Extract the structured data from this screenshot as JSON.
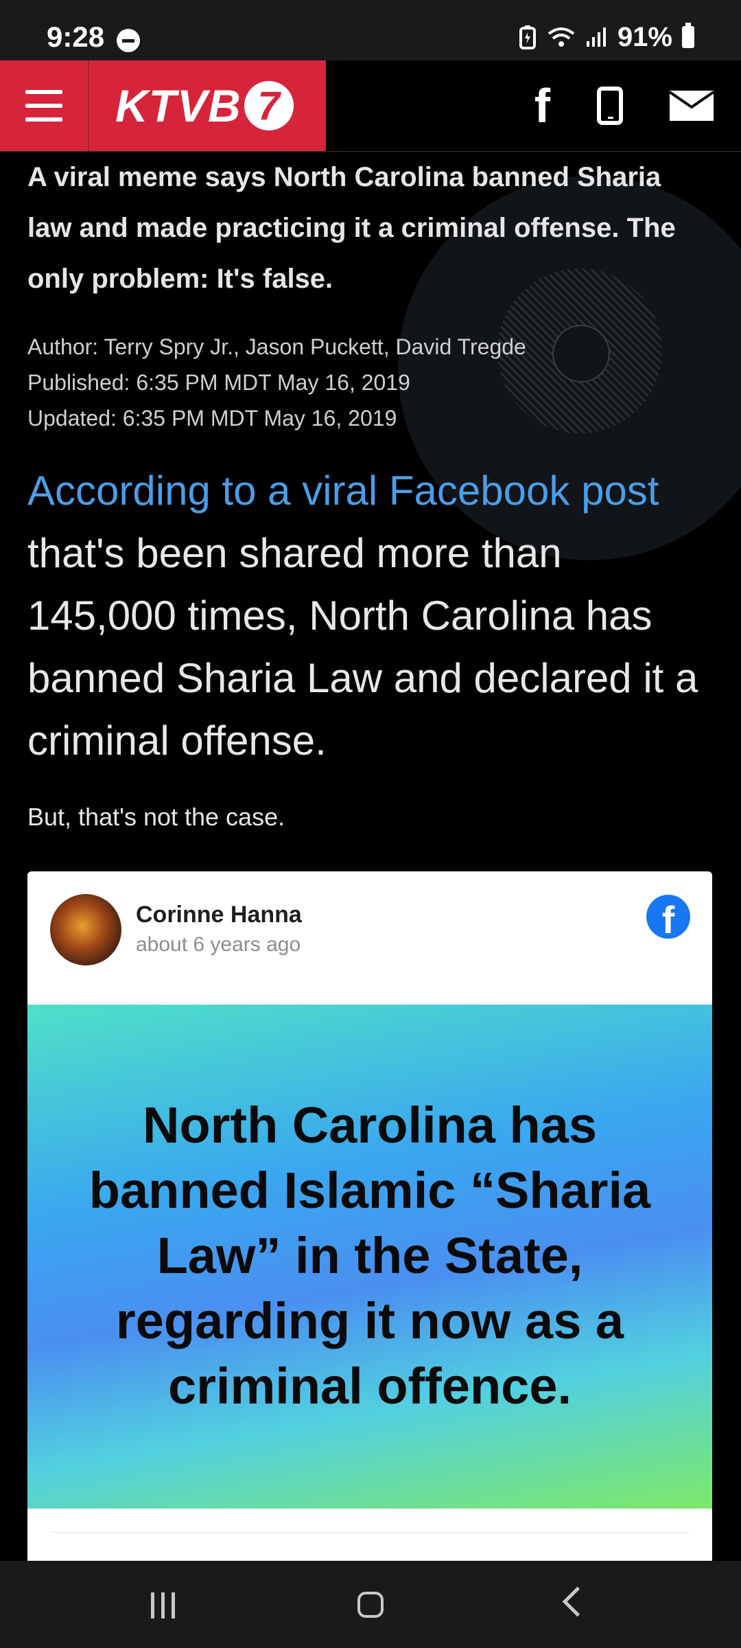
{
  "status_bar": {
    "time": "9:28",
    "battery_percent": "91%",
    "icons": [
      "dnd-icon",
      "battery-saver-icon",
      "wifi-icon",
      "signal-icon",
      "battery-icon"
    ]
  },
  "header": {
    "logo_text": "KTVB",
    "logo_number": "7",
    "icons": [
      "menu-icon",
      "facebook-icon",
      "phone-icon",
      "mail-icon"
    ],
    "brand_color": "#d6253a"
  },
  "article": {
    "subheadline": "A viral meme says North Carolina banned Sharia law and made practicing it a criminal offense. The only problem: It's false.",
    "author": "Author: Terry Spry Jr., Jason Puckett, David Tregde",
    "published": "Published: 6:35 PM MDT May 16, 2019",
    "updated": "Updated: 6:35 PM MDT May 16, 2019",
    "lead_link": "According to a viral Facebook post",
    "lead_rest": " that's been shared more than 145,000 times, North Carolina has banned Sharia Law and declared it a criminal offense.",
    "paragraph": "But, that's not the case.",
    "link_color": "#4a9ee8"
  },
  "facebook_embed": {
    "name": "Corinne Hanna",
    "time_ago": "about 6 years ago",
    "post_image_text": "North Carolina has banned Islamic “Sharia Law” in the State, regarding it now as a criminal offence.",
    "stats": "",
    "fb_color": "#1877f2"
  },
  "nav_bar": {
    "icons": [
      "recent-apps-icon",
      "home-icon",
      "back-icon"
    ]
  }
}
